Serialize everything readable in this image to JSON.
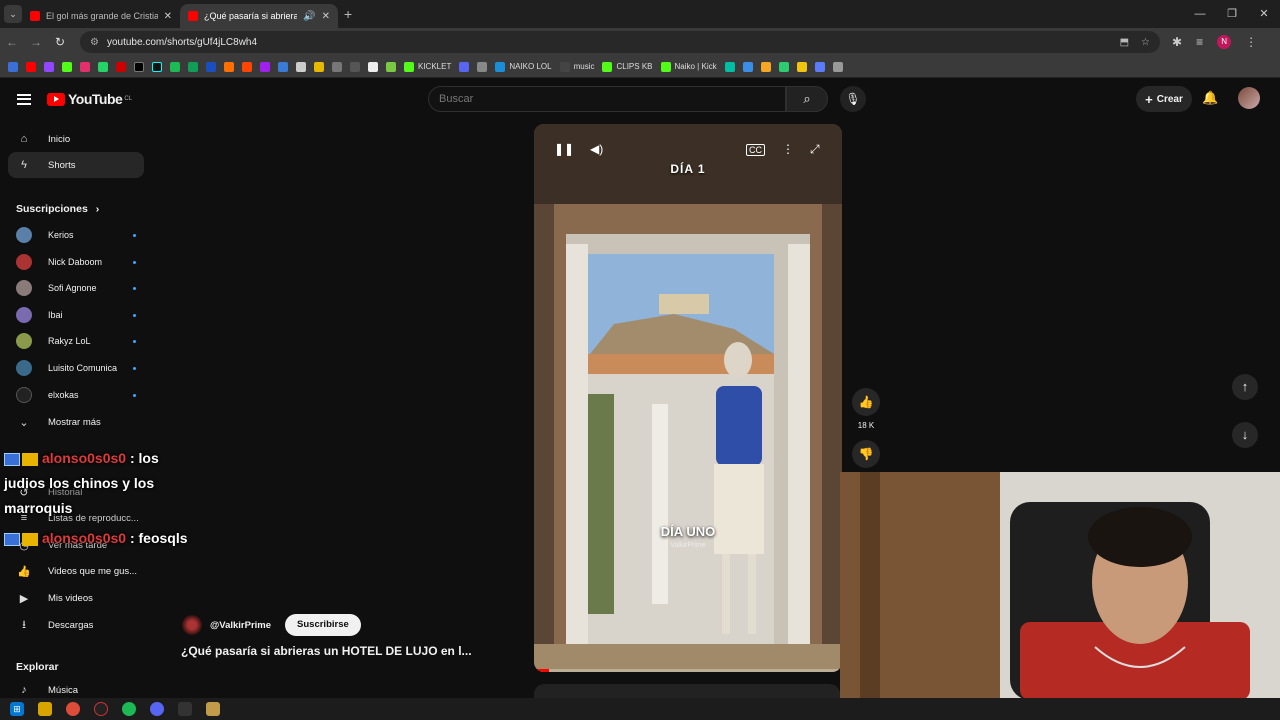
{
  "browser": {
    "tabs": [
      {
        "title": "El gol más grande de Cristiano",
        "active": false
      },
      {
        "title": "¿Qué pasaría si abrieras un",
        "active": true
      }
    ],
    "url": "youtube.com/shorts/gUf4jLC8wh4",
    "bookmarks": [
      "KICKLET",
      "NAIKO LOL",
      "music",
      "CLIPS KB",
      "Naiko | Kick"
    ],
    "profile_initial": "N"
  },
  "youtube": {
    "logo_text": "YouTube",
    "country_code": "CL",
    "search_placeholder": "Buscar",
    "create_label": "Crear"
  },
  "sidebar": {
    "nav": [
      {
        "label": "Inicio",
        "icon": "home-icon"
      },
      {
        "label": "Shorts",
        "icon": "shorts-icon",
        "active": true
      }
    ],
    "subscriptions_title": "Suscripciones",
    "subscriptions": [
      {
        "name": "Kerios",
        "color": "#5a7fa8"
      },
      {
        "name": "Nick Daboom",
        "color": "#a33"
      },
      {
        "name": "Sofi Agnone",
        "color": "#8a7a7a"
      },
      {
        "name": "Ibai",
        "color": "#7a6ab0"
      },
      {
        "name": "Rakyz LoL",
        "color": "#8a9a4a"
      },
      {
        "name": "Luisito Comunica",
        "color": "#3a6a8a"
      },
      {
        "name": "elxokas",
        "color": "#222"
      }
    ],
    "show_more": "Mostrar más",
    "you_items": [
      {
        "label": "Historial",
        "icon": "history-icon"
      },
      {
        "label": "Listas de reproducc...",
        "icon": "playlist-icon"
      },
      {
        "label": "Ver más tarde",
        "icon": "clock-icon"
      },
      {
        "label": "Videos que me gus...",
        "icon": "thumbs-up-icon"
      },
      {
        "label": "Mis videos",
        "icon": "video-icon"
      },
      {
        "label": "Descargas",
        "icon": "download-icon"
      }
    ],
    "explore_title": "Explorar",
    "explore_items": [
      {
        "label": "Música",
        "icon": "music-icon"
      }
    ]
  },
  "chat": [
    {
      "user": "alonso0s0s0",
      "message": ": los judios los chinos y los marroquis"
    },
    {
      "user": "alonso0s0s0",
      "message": ": feosqls"
    }
  ],
  "short": {
    "overlay_top": "DÍA 1",
    "overlay_mid": "DÍA UNO",
    "overlay_watermark": "ValkirPrime",
    "progress": 0.05,
    "likes": "18 K",
    "channel": "@ValkirPrime",
    "subscribe_label": "Suscribirse",
    "title": "¿Qué pasaría si abrieras un HOTEL DE LUJO en l..."
  }
}
